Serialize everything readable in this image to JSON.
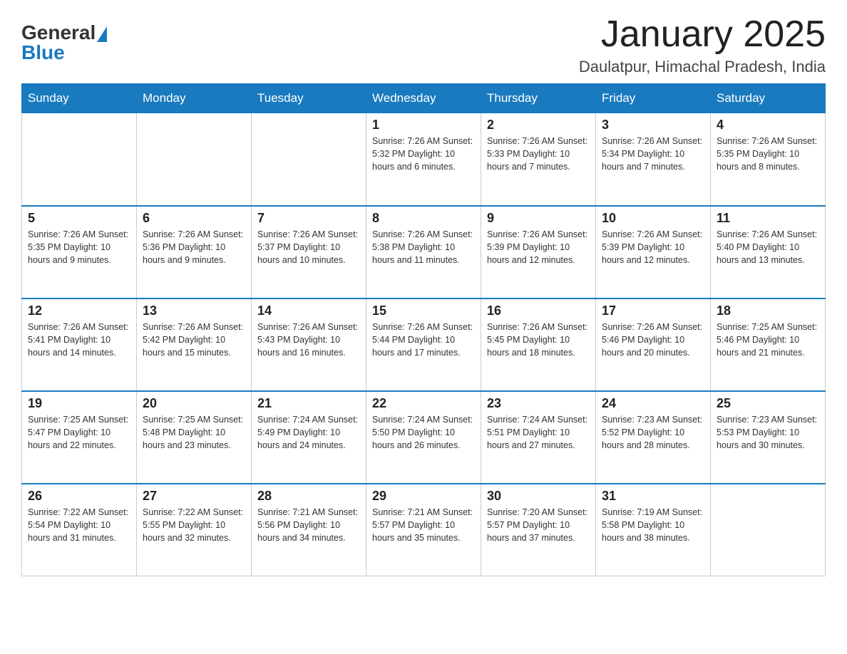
{
  "header": {
    "logo_general": "General",
    "logo_blue": "Blue",
    "month_year": "January 2025",
    "location": "Daulatpur, Himachal Pradesh, India"
  },
  "days_of_week": [
    "Sunday",
    "Monday",
    "Tuesday",
    "Wednesday",
    "Thursday",
    "Friday",
    "Saturday"
  ],
  "weeks": [
    [
      {
        "day": "",
        "info": ""
      },
      {
        "day": "",
        "info": ""
      },
      {
        "day": "",
        "info": ""
      },
      {
        "day": "1",
        "info": "Sunrise: 7:26 AM\nSunset: 5:32 PM\nDaylight: 10 hours and 6 minutes."
      },
      {
        "day": "2",
        "info": "Sunrise: 7:26 AM\nSunset: 5:33 PM\nDaylight: 10 hours and 7 minutes."
      },
      {
        "day": "3",
        "info": "Sunrise: 7:26 AM\nSunset: 5:34 PM\nDaylight: 10 hours and 7 minutes."
      },
      {
        "day": "4",
        "info": "Sunrise: 7:26 AM\nSunset: 5:35 PM\nDaylight: 10 hours and 8 minutes."
      }
    ],
    [
      {
        "day": "5",
        "info": "Sunrise: 7:26 AM\nSunset: 5:35 PM\nDaylight: 10 hours and 9 minutes."
      },
      {
        "day": "6",
        "info": "Sunrise: 7:26 AM\nSunset: 5:36 PM\nDaylight: 10 hours and 9 minutes."
      },
      {
        "day": "7",
        "info": "Sunrise: 7:26 AM\nSunset: 5:37 PM\nDaylight: 10 hours and 10 minutes."
      },
      {
        "day": "8",
        "info": "Sunrise: 7:26 AM\nSunset: 5:38 PM\nDaylight: 10 hours and 11 minutes."
      },
      {
        "day": "9",
        "info": "Sunrise: 7:26 AM\nSunset: 5:39 PM\nDaylight: 10 hours and 12 minutes."
      },
      {
        "day": "10",
        "info": "Sunrise: 7:26 AM\nSunset: 5:39 PM\nDaylight: 10 hours and 12 minutes."
      },
      {
        "day": "11",
        "info": "Sunrise: 7:26 AM\nSunset: 5:40 PM\nDaylight: 10 hours and 13 minutes."
      }
    ],
    [
      {
        "day": "12",
        "info": "Sunrise: 7:26 AM\nSunset: 5:41 PM\nDaylight: 10 hours and 14 minutes."
      },
      {
        "day": "13",
        "info": "Sunrise: 7:26 AM\nSunset: 5:42 PM\nDaylight: 10 hours and 15 minutes."
      },
      {
        "day": "14",
        "info": "Sunrise: 7:26 AM\nSunset: 5:43 PM\nDaylight: 10 hours and 16 minutes."
      },
      {
        "day": "15",
        "info": "Sunrise: 7:26 AM\nSunset: 5:44 PM\nDaylight: 10 hours and 17 minutes."
      },
      {
        "day": "16",
        "info": "Sunrise: 7:26 AM\nSunset: 5:45 PM\nDaylight: 10 hours and 18 minutes."
      },
      {
        "day": "17",
        "info": "Sunrise: 7:26 AM\nSunset: 5:46 PM\nDaylight: 10 hours and 20 minutes."
      },
      {
        "day": "18",
        "info": "Sunrise: 7:25 AM\nSunset: 5:46 PM\nDaylight: 10 hours and 21 minutes."
      }
    ],
    [
      {
        "day": "19",
        "info": "Sunrise: 7:25 AM\nSunset: 5:47 PM\nDaylight: 10 hours and 22 minutes."
      },
      {
        "day": "20",
        "info": "Sunrise: 7:25 AM\nSunset: 5:48 PM\nDaylight: 10 hours and 23 minutes."
      },
      {
        "day": "21",
        "info": "Sunrise: 7:24 AM\nSunset: 5:49 PM\nDaylight: 10 hours and 24 minutes."
      },
      {
        "day": "22",
        "info": "Sunrise: 7:24 AM\nSunset: 5:50 PM\nDaylight: 10 hours and 26 minutes."
      },
      {
        "day": "23",
        "info": "Sunrise: 7:24 AM\nSunset: 5:51 PM\nDaylight: 10 hours and 27 minutes."
      },
      {
        "day": "24",
        "info": "Sunrise: 7:23 AM\nSunset: 5:52 PM\nDaylight: 10 hours and 28 minutes."
      },
      {
        "day": "25",
        "info": "Sunrise: 7:23 AM\nSunset: 5:53 PM\nDaylight: 10 hours and 30 minutes."
      }
    ],
    [
      {
        "day": "26",
        "info": "Sunrise: 7:22 AM\nSunset: 5:54 PM\nDaylight: 10 hours and 31 minutes."
      },
      {
        "day": "27",
        "info": "Sunrise: 7:22 AM\nSunset: 5:55 PM\nDaylight: 10 hours and 32 minutes."
      },
      {
        "day": "28",
        "info": "Sunrise: 7:21 AM\nSunset: 5:56 PM\nDaylight: 10 hours and 34 minutes."
      },
      {
        "day": "29",
        "info": "Sunrise: 7:21 AM\nSunset: 5:57 PM\nDaylight: 10 hours and 35 minutes."
      },
      {
        "day": "30",
        "info": "Sunrise: 7:20 AM\nSunset: 5:57 PM\nDaylight: 10 hours and 37 minutes."
      },
      {
        "day": "31",
        "info": "Sunrise: 7:19 AM\nSunset: 5:58 PM\nDaylight: 10 hours and 38 minutes."
      },
      {
        "day": "",
        "info": ""
      }
    ]
  ]
}
